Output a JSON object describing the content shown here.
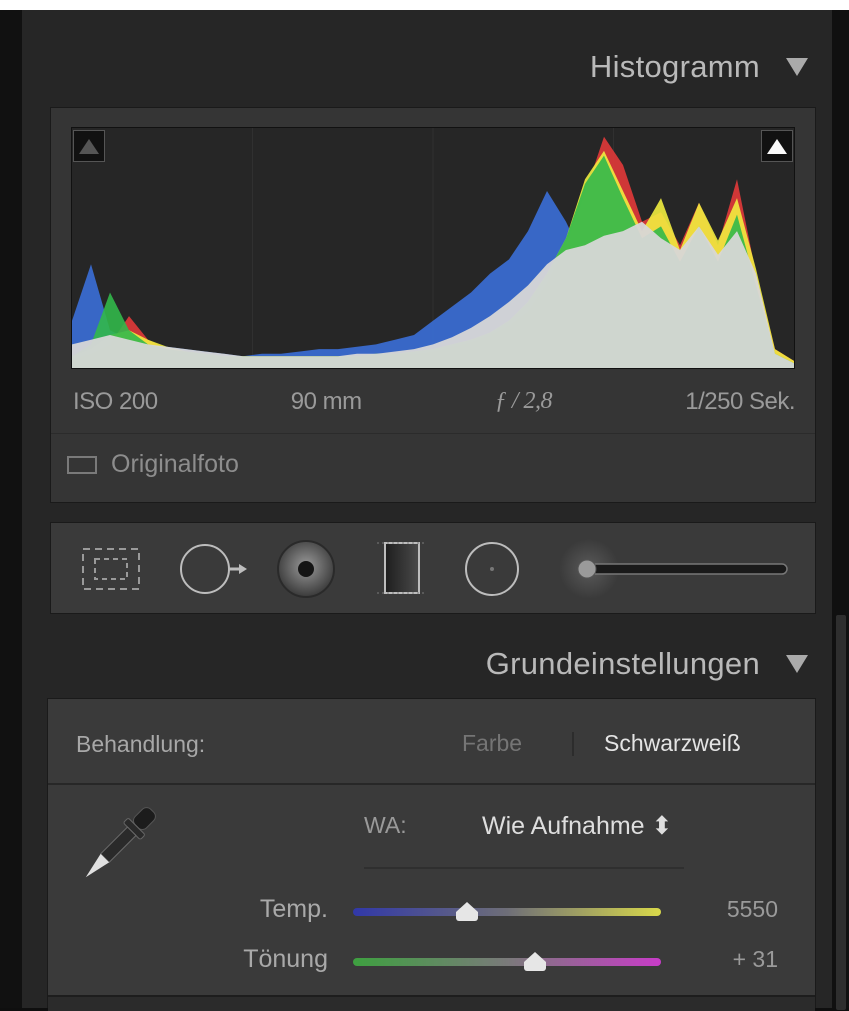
{
  "histogram": {
    "title": "Histogramm",
    "chart_data": {
      "type": "area",
      "series": [
        {
          "channel": "luminance",
          "color": "#d7d7d7",
          "values": [
            0.1,
            0.12,
            0.14,
            0.12,
            0.1,
            0.09,
            0.08,
            0.07,
            0.06,
            0.05,
            0.05,
            0.05,
            0.05,
            0.05,
            0.05,
            0.06,
            0.06,
            0.07,
            0.08,
            0.1,
            0.13,
            0.17,
            0.22,
            0.28,
            0.35,
            0.44,
            0.5,
            0.52,
            0.56,
            0.58,
            0.62,
            0.55,
            0.5,
            0.6,
            0.48,
            0.58,
            0.4,
            0.06,
            0.02
          ]
        },
        {
          "channel": "blue",
          "color": "#3b6fd8",
          "values": [
            0.2,
            0.44,
            0.16,
            0.12,
            0.1,
            0.09,
            0.08,
            0.07,
            0.06,
            0.05,
            0.06,
            0.06,
            0.07,
            0.08,
            0.08,
            0.09,
            0.1,
            0.12,
            0.14,
            0.2,
            0.26,
            0.32,
            0.4,
            0.46,
            0.58,
            0.75,
            0.62,
            0.45,
            0.4,
            0.3,
            0.2,
            0.1,
            0.05,
            0.02,
            0.01,
            0.01,
            0.01,
            0.01,
            0.01
          ]
        },
        {
          "channel": "yellow",
          "color": "#f1ed3f",
          "values": [
            0.05,
            0.08,
            0.14,
            0.16,
            0.12,
            0.09,
            0.07,
            0.06,
            0.05,
            0.05,
            0.05,
            0.05,
            0.05,
            0.05,
            0.05,
            0.05,
            0.06,
            0.06,
            0.07,
            0.08,
            0.1,
            0.12,
            0.15,
            0.2,
            0.28,
            0.4,
            0.55,
            0.8,
            0.92,
            0.75,
            0.58,
            0.72,
            0.5,
            0.7,
            0.54,
            0.72,
            0.42,
            0.08,
            0.03
          ]
        },
        {
          "channel": "red",
          "color": "#e23a3a",
          "values": [
            0.04,
            0.06,
            0.1,
            0.22,
            0.12,
            0.08,
            0.07,
            0.06,
            0.05,
            0.05,
            0.05,
            0.05,
            0.05,
            0.05,
            0.05,
            0.05,
            0.05,
            0.06,
            0.06,
            0.07,
            0.09,
            0.11,
            0.14,
            0.18,
            0.24,
            0.36,
            0.52,
            0.74,
            0.98,
            0.86,
            0.62,
            0.66,
            0.52,
            0.7,
            0.52,
            0.8,
            0.4,
            0.08,
            0.03
          ]
        },
        {
          "channel": "green",
          "color": "#32b84a",
          "values": [
            0.05,
            0.1,
            0.32,
            0.16,
            0.1,
            0.08,
            0.07,
            0.06,
            0.05,
            0.05,
            0.05,
            0.05,
            0.05,
            0.05,
            0.05,
            0.05,
            0.06,
            0.06,
            0.07,
            0.08,
            0.1,
            0.12,
            0.15,
            0.2,
            0.28,
            0.4,
            0.55,
            0.78,
            0.9,
            0.72,
            0.55,
            0.6,
            0.45,
            0.6,
            0.45,
            0.65,
            0.35,
            0.06,
            0.02
          ]
        }
      ]
    },
    "exif": {
      "iso": "ISO 200",
      "focal": "90 mm",
      "aperture": "ƒ / 2,8",
      "shutter": "1/250 Sek."
    },
    "original_photo": "Originalfoto"
  },
  "tools": {
    "icons": [
      "crop-overlay-icon",
      "spot-removal-icon",
      "red-eye-icon",
      "graduated-filter-icon",
      "radial-filter-icon",
      "adjustment-brush-icon"
    ]
  },
  "basic": {
    "title": "Grundeinstellungen",
    "treatment_label": "Behandlung:",
    "treatment_color": "Farbe",
    "treatment_bw": "Schwarzweiß",
    "wb_label": "WA:",
    "wb_value": "Wie Aufnahme ⬍",
    "temp_label": "Temp.",
    "temp_value": "5550",
    "temp_level": 0.37,
    "tint_label": "Tönung",
    "tint_value": "+ 31",
    "tint_level": 0.59
  }
}
